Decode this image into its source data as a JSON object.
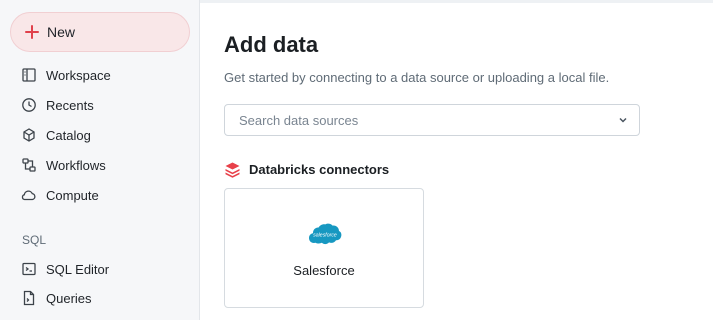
{
  "sidebar": {
    "new_label": "New",
    "items": [
      {
        "label": "Workspace",
        "icon": "workspace-icon"
      },
      {
        "label": "Recents",
        "icon": "clock-icon"
      },
      {
        "label": "Catalog",
        "icon": "catalog-icon"
      },
      {
        "label": "Workflows",
        "icon": "workflows-icon"
      },
      {
        "label": "Compute",
        "icon": "cloud-icon"
      }
    ],
    "sql_section": {
      "title": "SQL",
      "items": [
        {
          "label": "SQL Editor",
          "icon": "sql-editor-icon"
        },
        {
          "label": "Queries",
          "icon": "queries-icon"
        }
      ]
    }
  },
  "main": {
    "title": "Add data",
    "subtitle": "Get started by connecting to a data source or uploading a local file.",
    "search": {
      "placeholder": "Search data sources",
      "value": ""
    },
    "connectors": {
      "title": "Databricks connectors",
      "cards": [
        {
          "name": "Salesforce",
          "logo_text": "salesforce",
          "icon": "salesforce-logo"
        }
      ]
    }
  },
  "colors": {
    "accent": "#e0414b",
    "new_button_bg": "#f9e7e8",
    "sidebar_bg": "#f6f7f9",
    "salesforce_blue": "#1798c1"
  }
}
